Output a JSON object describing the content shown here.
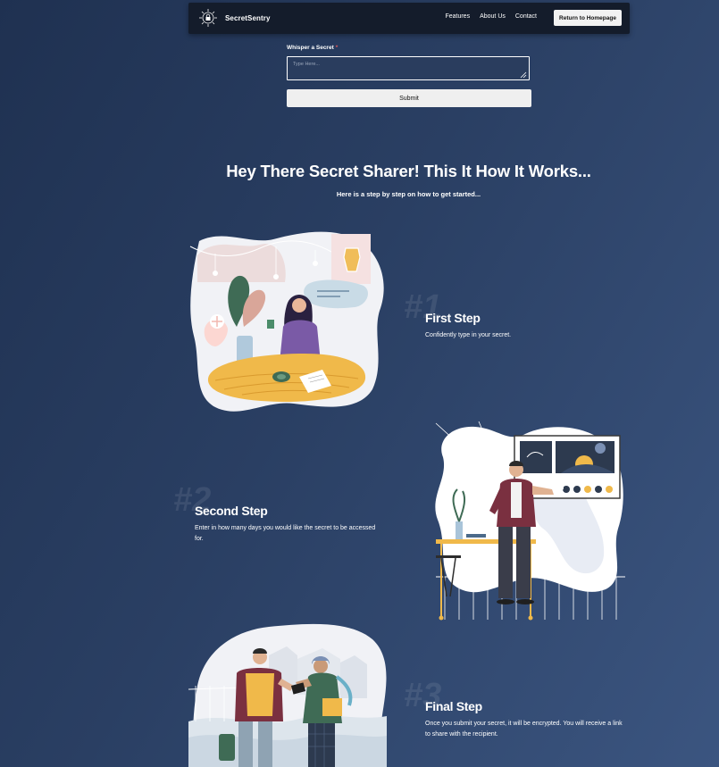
{
  "navbar": {
    "brand": "SecretSentry",
    "links": [
      "Features",
      "About Us",
      "Contact"
    ],
    "home_button": "Return to Homepage"
  },
  "form": {
    "label": "Whisper a Secret",
    "required_mark": "*",
    "placeholder": "Type Here...",
    "value": "",
    "submit_label": "Submit"
  },
  "hero": {
    "title": "Hey There Secret Sharer! This It How It Works...",
    "subtitle": "Here is a step by step on how to get started..."
  },
  "steps": [
    {
      "number": "#1",
      "title": "First Step",
      "description": "Confidently type in your secret."
    },
    {
      "number": "#2",
      "title": "Second Step",
      "description": "Enter in how many days you would like the secret to be accessed for."
    },
    {
      "number": "#3",
      "title": "Final Step",
      "description": "Once you submit your secret, it will be encrypted. You will receive a link to share with the recipient."
    }
  ],
  "colors": {
    "background_start": "#1f3151",
    "background_end": "#3b5580",
    "navbar": "#141c2b",
    "button": "#efefef",
    "accent_yellow": "#f0b94a"
  },
  "icons": {
    "brand_logo": "shield-lock-icon",
    "resize": "resize-handle-icon"
  }
}
